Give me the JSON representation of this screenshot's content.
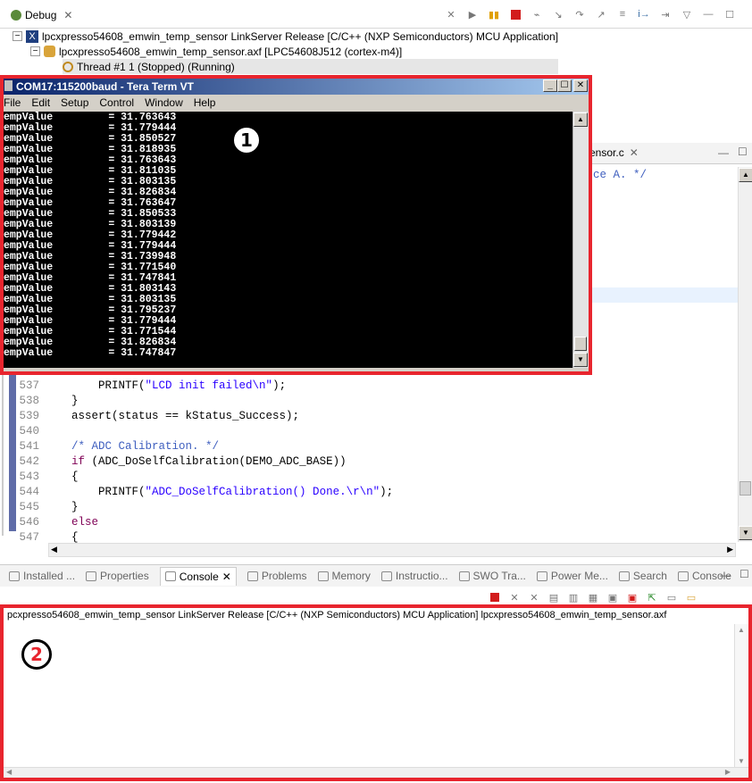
{
  "debug": {
    "tab_label": "Debug",
    "tree": [
      {
        "label": "lpcxpresso54608_emwin_temp_sensor LinkServer Release [C/C++ (NXP Semiconductors) MCU Application]",
        "toggle": "−"
      },
      {
        "label": "lpcxpresso54608_emwin_temp_sensor.axf [LPC54608J512 (cortex-m4)]",
        "toggle": "−"
      },
      {
        "label": "Thread #1 1 (Stopped) (Running)",
        "toggle": ""
      }
    ]
  },
  "editor": {
    "tab_label": "ensor.c",
    "comment_fragment": "ce A. */",
    "lines": [
      {
        "num": "537",
        "indent": "        ",
        "parts": [
          {
            "t": "PRINTF(",
            "c": ""
          },
          {
            "t": "\"LCD init failed\\n\"",
            "c": "str"
          },
          {
            "t": ");",
            "c": ""
          }
        ]
      },
      {
        "num": "538",
        "indent": "    ",
        "parts": [
          {
            "t": "}",
            "c": ""
          }
        ]
      },
      {
        "num": "539",
        "indent": "    ",
        "parts": [
          {
            "t": "assert(status == kStatus_Success);",
            "c": ""
          }
        ]
      },
      {
        "num": "540",
        "indent": "",
        "parts": []
      },
      {
        "num": "541",
        "indent": "    ",
        "parts": [
          {
            "t": "/* ADC Calibration. */",
            "c": "cm"
          }
        ]
      },
      {
        "num": "542",
        "indent": "    ",
        "parts": [
          {
            "t": "if",
            "c": "kw"
          },
          {
            "t": " (ADC_DoSelfCalibration(DEMO_ADC_BASE))",
            "c": ""
          }
        ]
      },
      {
        "num": "543",
        "indent": "    ",
        "parts": [
          {
            "t": "{",
            "c": ""
          }
        ]
      },
      {
        "num": "544",
        "indent": "        ",
        "parts": [
          {
            "t": "PRINTF(",
            "c": ""
          },
          {
            "t": "\"ADC_DoSelfCalibration() Done.\\r\\n\"",
            "c": "str"
          },
          {
            "t": ");",
            "c": ""
          }
        ]
      },
      {
        "num": "545",
        "indent": "    ",
        "parts": [
          {
            "t": "}",
            "c": ""
          }
        ]
      },
      {
        "num": "546",
        "indent": "    ",
        "parts": [
          {
            "t": "else",
            "c": "kw"
          }
        ]
      },
      {
        "num": "547",
        "indent": "    ",
        "parts": [
          {
            "t": "{",
            "c": ""
          }
        ]
      }
    ]
  },
  "teraterm": {
    "title": "COM17:115200baud - Tera Term VT",
    "menu": [
      "File",
      "Edit",
      "Setup",
      "Control",
      "Window",
      "Help"
    ],
    "prefix": "empValue         = ",
    "values": [
      "31.763643",
      "31.779444",
      "31.850527",
      "31.818935",
      "31.763643",
      "31.811035",
      "31.803135",
      "31.826834",
      "31.763647",
      "31.850533",
      "31.803139",
      "31.779442",
      "31.779444",
      "31.739948",
      "31.771540",
      "31.747841",
      "31.803143",
      "31.803135",
      "31.795237",
      "31.779444",
      "31.771544",
      "31.826834",
      "31.747847"
    ],
    "badge": "1"
  },
  "panel": {
    "tabs": [
      "Installed ...",
      "Properties",
      "Console",
      "Problems",
      "Memory",
      "Instructio...",
      "SWO Tra...",
      "Power Me...",
      "Search",
      "Console"
    ],
    "active_tab_index": 2
  },
  "console": {
    "header": "pcxpresso54608_emwin_temp_sensor LinkServer Release [C/C++ (NXP Semiconductors) MCU Application] lpcxpresso54608_emwin_temp_sensor.axf",
    "badge": "2"
  }
}
